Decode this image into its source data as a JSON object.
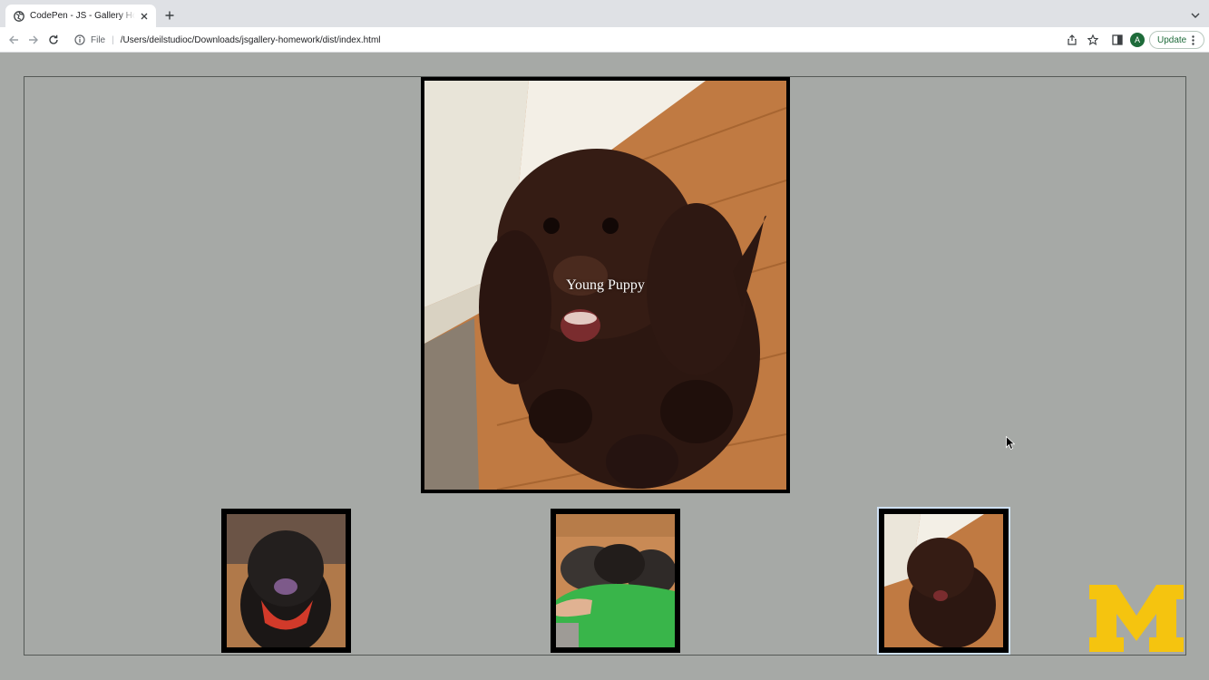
{
  "browser": {
    "tab_title": "CodePen - JS - Gallery Homework",
    "scheme_label": "File",
    "scheme_separator": "|",
    "url": "/Users/deilstudioc/Downloads/jsgallery-homework/dist/index.html",
    "profile_initial": "A",
    "update_label": "Update",
    "accent_color": "#1e6b3a"
  },
  "gallery": {
    "main_caption": "Young Puppy",
    "thumbnails": [
      {
        "alt": "dog with red bandana",
        "active": false
      },
      {
        "alt": "puppies with child in green shirt",
        "active": false
      },
      {
        "alt": "young puppy sitting on wood floor",
        "active": true
      }
    ]
  },
  "logo": {
    "text": "M",
    "color": "#f5c40f"
  }
}
